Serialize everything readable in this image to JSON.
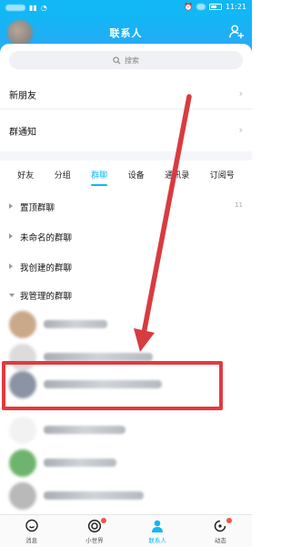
{
  "status_bar": {
    "battery_text": "11:21",
    "carrier_chip": "中国"
  },
  "header": {
    "title": "联系人"
  },
  "search": {
    "placeholder": "搜索"
  },
  "menu_rows": [
    {
      "label": "新朋友"
    },
    {
      "label": "群通知"
    }
  ],
  "tabs": [
    {
      "label": "好友",
      "active": false
    },
    {
      "label": "分组",
      "active": false
    },
    {
      "label": "群聊",
      "active": true
    },
    {
      "label": "设备",
      "active": false
    },
    {
      "label": "通讯录",
      "active": false
    },
    {
      "label": "订阅号",
      "active": false
    }
  ],
  "groups": [
    {
      "label": "置顶群聊",
      "count": "11",
      "expanded": false
    },
    {
      "label": "未命名的群聊",
      "count": "",
      "expanded": false
    },
    {
      "label": "我创建的群聊",
      "count": "",
      "expanded": false
    },
    {
      "label": "我管理的群聊",
      "count": "",
      "expanded": true
    }
  ],
  "contacts": [
    {
      "avatar_color": "#c9a98a",
      "name_width": 70
    },
    {
      "avatar_color": "#dcdcdc",
      "name_width": 120
    },
    {
      "avatar_color": "#8c93a5",
      "name_width": 130
    },
    {
      "avatar_color": "#f2f2f2",
      "name_width": 90
    },
    {
      "avatar_color": "#6fb46e",
      "name_width": 80
    },
    {
      "avatar_color": "#b9b9b9",
      "name_width": 110
    }
  ],
  "bottom_nav": [
    {
      "label": "消息",
      "icon": "message-icon",
      "active": false,
      "dot": false
    },
    {
      "label": "小世界",
      "icon": "world-icon",
      "active": false,
      "dot": true
    },
    {
      "label": "联系人",
      "icon": "contacts-icon",
      "active": true,
      "dot": false
    },
    {
      "label": "动态",
      "icon": "moments-icon",
      "active": false,
      "dot": true
    }
  ],
  "colors": {
    "accent": "#12b7f5",
    "highlight": "#e23a3f",
    "arrow": "#d83b40"
  }
}
